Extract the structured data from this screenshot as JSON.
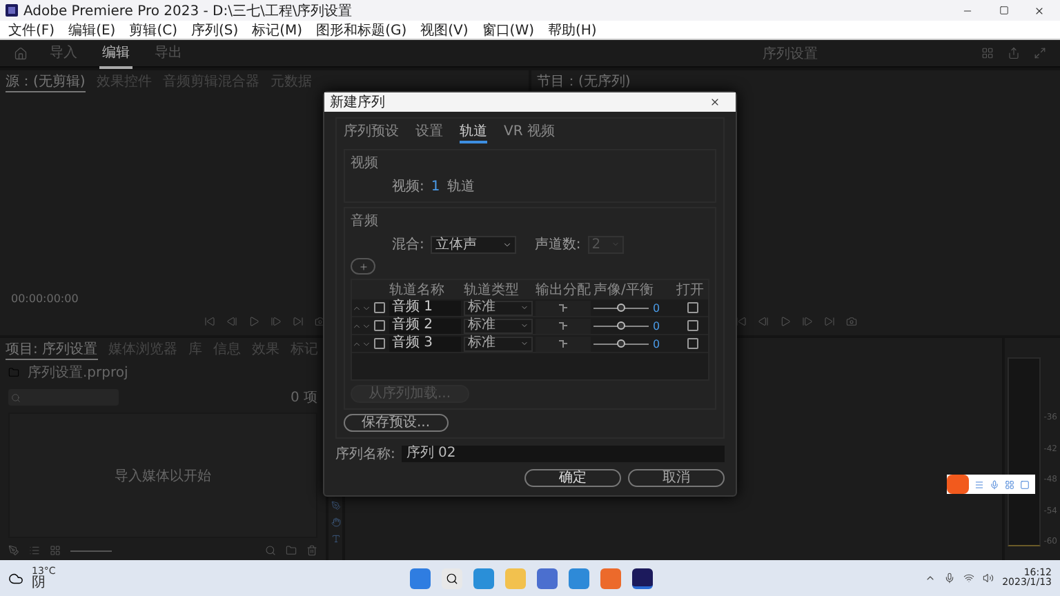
{
  "window": {
    "title": "Adobe Premiere Pro 2023 - D:\\三七\\工程\\序列设置"
  },
  "menu": [
    "文件(F)",
    "编辑(E)",
    "剪辑(C)",
    "序列(S)",
    "标记(M)",
    "图形和标题(G)",
    "视图(V)",
    "窗口(W)",
    "帮助(H)"
  ],
  "workspace_tabs": [
    {
      "label": "导入",
      "selected": false
    },
    {
      "label": "编辑",
      "selected": true
    },
    {
      "label": "导出",
      "selected": false
    }
  ],
  "header_title": "序列设置",
  "source_panel": {
    "tabs": [
      {
        "label": "源：(无剪辑)",
        "selected": true
      },
      {
        "label": "效果控件",
        "selected": false
      },
      {
        "label": "音频剪辑混合器",
        "selected": false
      },
      {
        "label": "元数据",
        "selected": false
      }
    ],
    "timecode": "00:00:00:00"
  },
  "program_panel": {
    "tabs": [
      {
        "label": "节目：(无序列)",
        "selected": true
      }
    ]
  },
  "project_panel": {
    "tabs": [
      {
        "label": "项目: 序列设置",
        "selected": true
      },
      {
        "label": "媒体浏览器",
        "selected": false
      },
      {
        "label": "库",
        "selected": false
      },
      {
        "label": "信息",
        "selected": false
      },
      {
        "label": "效果",
        "selected": false
      },
      {
        "label": "标记",
        "selected": false
      }
    ],
    "file": "序列设置.prproj",
    "item_count": "0 项",
    "empty_message": "导入媒体以开始"
  },
  "meter_scale": [
    "-36",
    "-42",
    "-48",
    "-54",
    "-60"
  ],
  "dialog": {
    "title": "新建序列",
    "tabs": [
      {
        "label": "序列预设",
        "selected": false
      },
      {
        "label": "设置",
        "selected": false
      },
      {
        "label": "轨道",
        "selected": true
      },
      {
        "label": "VR 视频",
        "selected": false
      }
    ],
    "video_group": "视频",
    "video_label": "视频:",
    "video_tracks": "1",
    "video_unit": "轨道",
    "audio_group": "音频",
    "mix_label": "混合:",
    "mix_value": "立体声",
    "channels_label": "声道数:",
    "channels_value": "2",
    "channels_disabled": true,
    "columns": [
      "轨道名称",
      "轨道类型",
      "输出分配",
      "声像/平衡",
      "打开"
    ],
    "tracks": [
      {
        "name": "音频 1",
        "type": "标准",
        "checked": false,
        "level": 0.5,
        "pan": "0",
        "open": false
      },
      {
        "name": "音频 2",
        "type": "标准",
        "checked": false,
        "level": 0.5,
        "pan": "0",
        "open": false
      },
      {
        "name": "音频 3",
        "type": "标准",
        "checked": false,
        "level": 0.5,
        "pan": "0",
        "open": false
      }
    ],
    "load_button": {
      "label": "从序列加载...",
      "disabled": true
    },
    "save_preset": "保存预设...",
    "name_label": "序列名称:",
    "name_value": "序列 02",
    "ok": "确定",
    "cancel": "取消"
  },
  "taskbar": {
    "temperature": "13°C",
    "weather": "阴",
    "time": "16:12",
    "date": "2023/1/13"
  }
}
